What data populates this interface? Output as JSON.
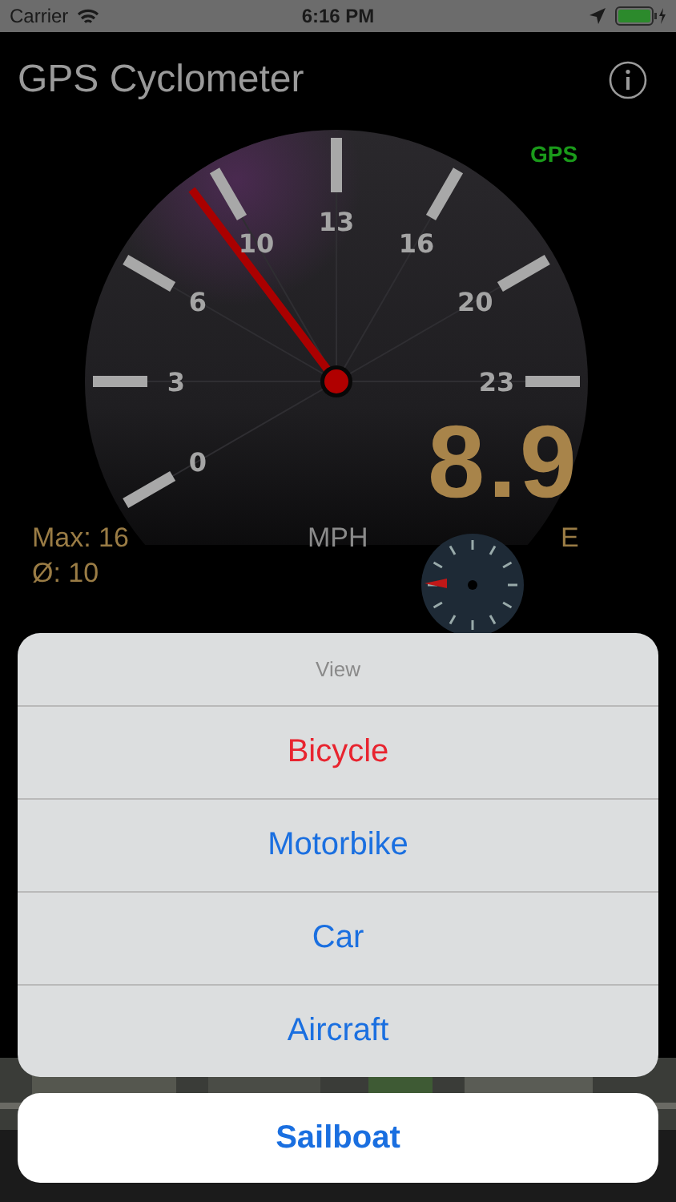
{
  "status_bar": {
    "carrier": "Carrier",
    "time": "6:16 PM"
  },
  "header": {
    "title": "GPS Cyclometer"
  },
  "gauge": {
    "gps_label": "GPS",
    "tick_labels": [
      "0",
      "3",
      "6",
      "10",
      "13",
      "16",
      "20",
      "23"
    ],
    "speed": "8.9",
    "unit": "MPH",
    "max": "Max: 16",
    "average": "Ø: 10",
    "heading": "E"
  },
  "action_sheet": {
    "title": "View",
    "options": [
      {
        "label": "Bicycle",
        "kind": "destructive"
      },
      {
        "label": "Motorbike",
        "kind": "default"
      },
      {
        "label": "Car",
        "kind": "default"
      },
      {
        "label": "Aircraft",
        "kind": "default"
      }
    ],
    "cancel": {
      "label": "Sailboat"
    }
  }
}
